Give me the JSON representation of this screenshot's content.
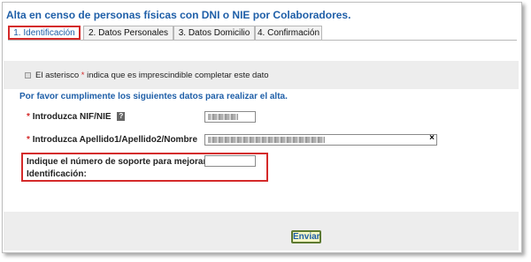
{
  "page": {
    "title": "Alta en censo de personas físicas con DNI o NIE por Colaboradores."
  },
  "tabs": [
    {
      "label": "1. Identificación",
      "active": true
    },
    {
      "label": "2. Datos Personales",
      "active": false
    },
    {
      "label": "3. Datos Domicilio",
      "active": false
    },
    {
      "label": "4. Confirmación",
      "active": false
    }
  ],
  "notice": {
    "before": "El asterisco ",
    "asterisk": "*",
    "after": " indica que es imprescindible completar este dato"
  },
  "form": {
    "instructions": "Por favor cumplimente los siguientes datos para realizar el alta.",
    "nif": {
      "asterisk": "*",
      "label": "Introduzca NIF/NIE",
      "help": "?",
      "value": "[redacted]"
    },
    "name": {
      "asterisk": "*",
      "label": "Introduzca Apellido1/Apellido2/Nombre",
      "value": "[redacted]",
      "clear": "×"
    },
    "support": {
      "label": "Indique el número de soporte para mejorar la Identificación:",
      "value": ""
    }
  },
  "actions": {
    "submit": "Enviar"
  },
  "colors": {
    "accent_blue": "#1f5fa8",
    "highlight_red": "#d42a2a",
    "button_fill": "#f6f7c8"
  }
}
